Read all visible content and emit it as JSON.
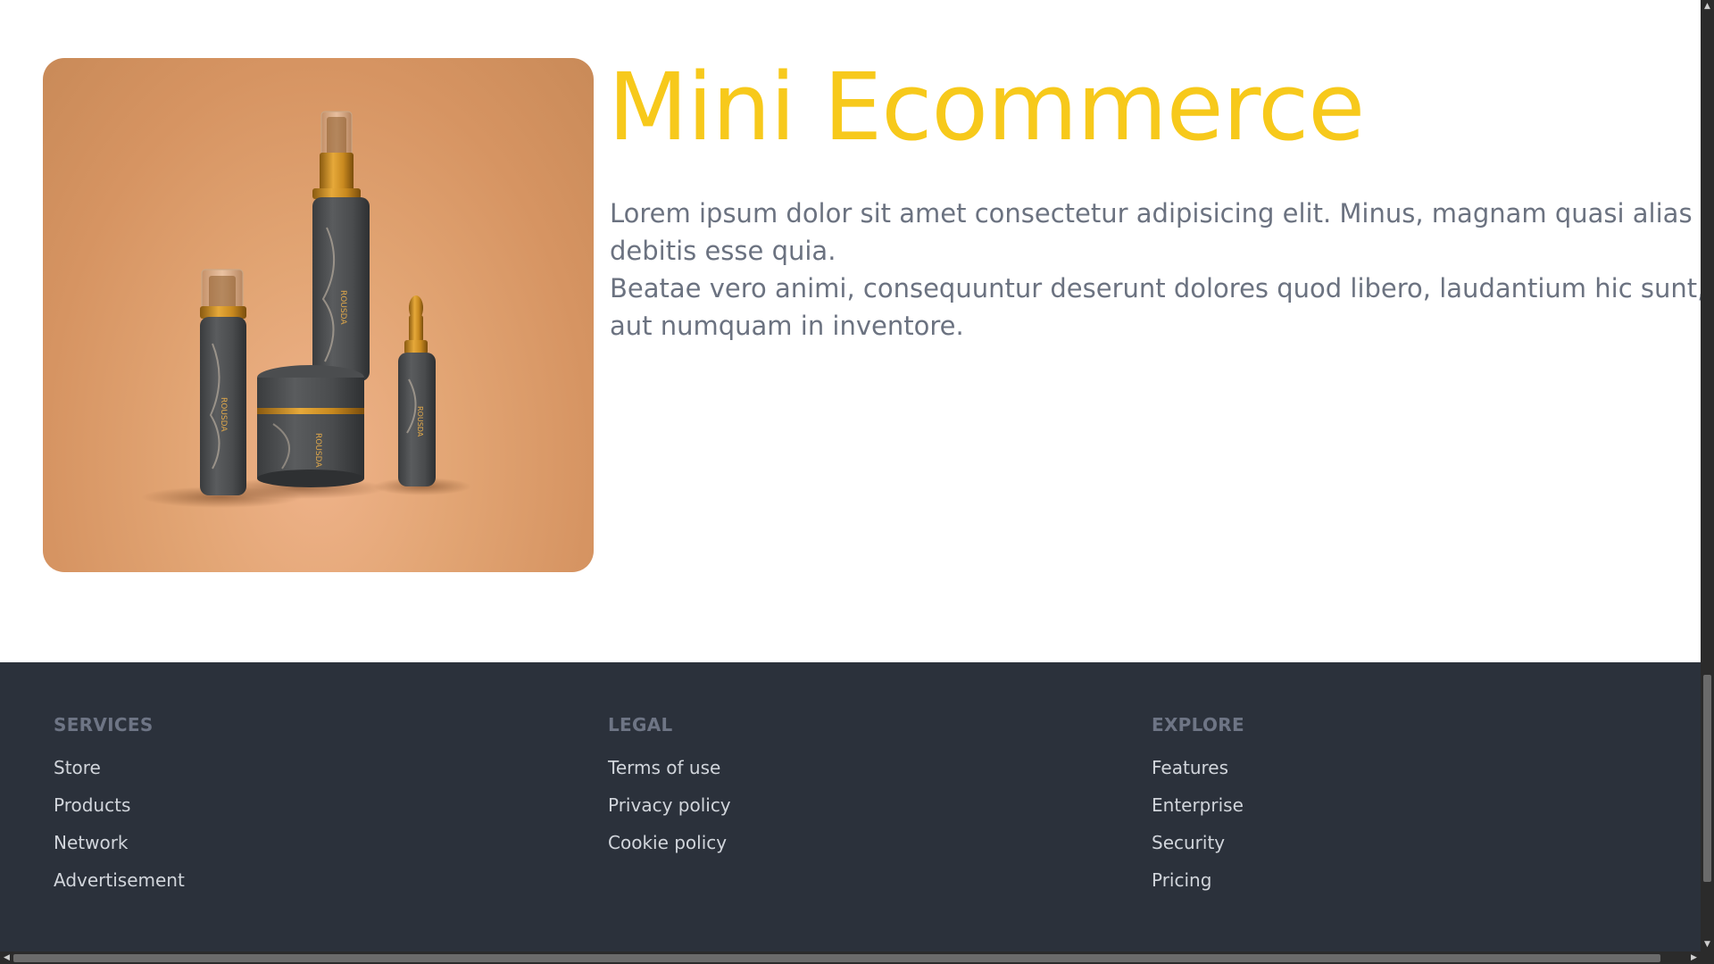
{
  "hero": {
    "title": "Mini Ecommerce",
    "paragraph_1": "Lorem ipsum dolor sit amet consectetur adipisicing elit. Minus, magnam quasi alias debitis esse quia.",
    "paragraph_2": "Beatae vero animi, consequuntur deserunt dolores quod libero, laudantium hic sunt, aut numquam in inventore.",
    "image_name": "cosmetic-products-image"
  },
  "footer": {
    "services": {
      "heading": "SERVICES",
      "links": [
        "Store",
        "Products",
        "Network",
        "Advertisement"
      ]
    },
    "legal": {
      "heading": "LEGAL",
      "links": [
        "Terms of use",
        "Privacy policy",
        "Cookie policy"
      ]
    },
    "explore": {
      "heading": "EXPLORE",
      "links": [
        "Features",
        "Enterprise",
        "Security",
        "Pricing"
      ]
    }
  },
  "colors": {
    "title": "#f7c91b",
    "body_text": "#6b7280",
    "footer_bg": "#2b313b",
    "footer_heading": "#6e7585",
    "footer_link": "#d1d5db"
  },
  "scrollbars": {
    "vertical_position": "bottom",
    "horizontal_position": "left"
  }
}
